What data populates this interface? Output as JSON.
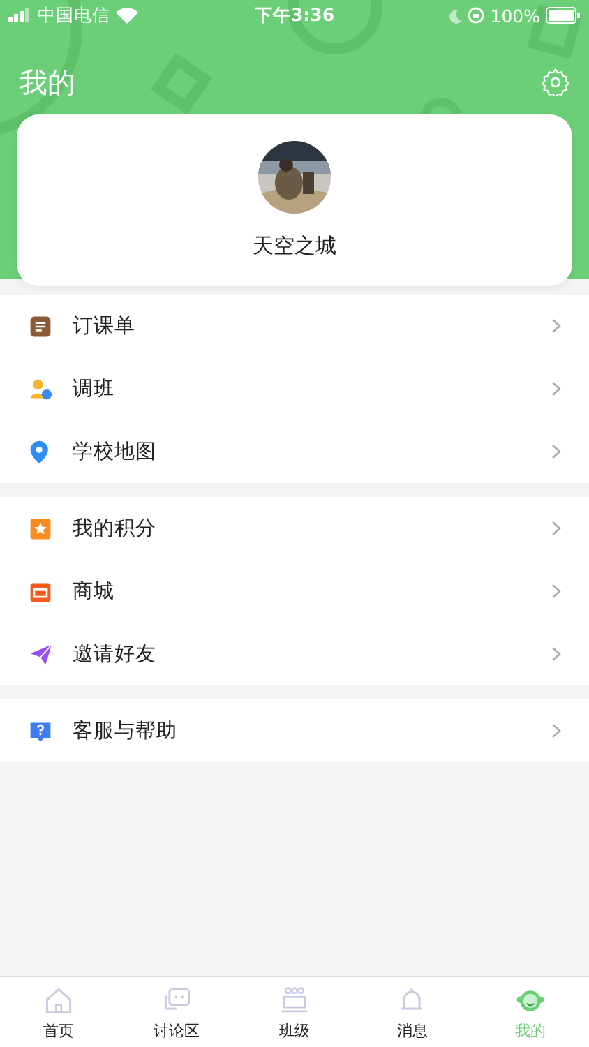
{
  "status_bar": {
    "carrier": "中国电信",
    "time": "下午3:36",
    "battery": "100%"
  },
  "header": {
    "title": "我的"
  },
  "profile": {
    "name": "天空之城"
  },
  "menu_groups": [
    {
      "items": [
        {
          "label": "订课单"
        },
        {
          "label": "调班"
        },
        {
          "label": "学校地图"
        }
      ]
    },
    {
      "items": [
        {
          "label": "我的积分"
        },
        {
          "label": "商城"
        },
        {
          "label": "邀请好友"
        }
      ]
    },
    {
      "items": [
        {
          "label": "客服与帮助"
        }
      ]
    }
  ],
  "tab_bar": [
    {
      "label": "首页",
      "selected": false
    },
    {
      "label": "讨论区",
      "selected": false
    },
    {
      "label": "班级",
      "selected": false
    },
    {
      "label": "消息",
      "selected": false
    },
    {
      "label": "我的",
      "selected": true
    }
  ]
}
